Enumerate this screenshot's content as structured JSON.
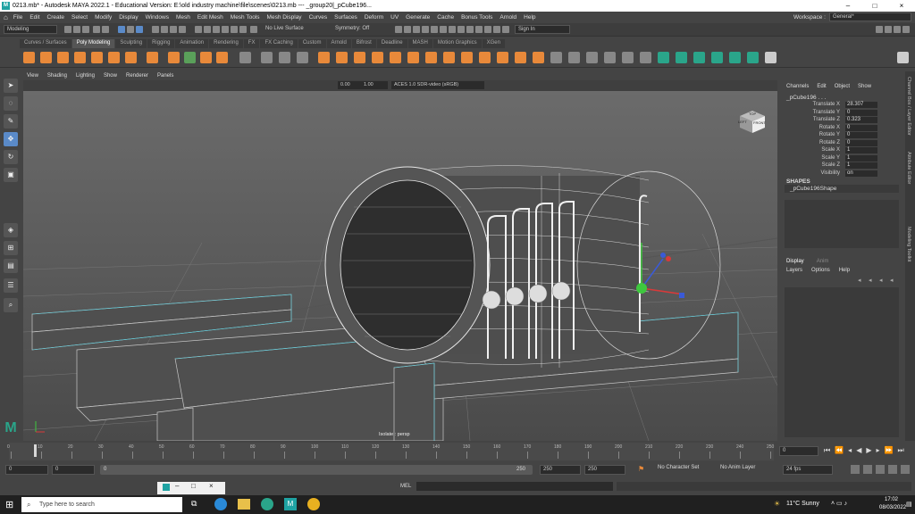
{
  "titlebar": {
    "text": "0213.mb* - Autodesk MAYA 2022.1 - Educational Version: E:\\old industry machine\\file\\scenes\\0213.mb  ---  _group20|_pCube196...",
    "logo": "M"
  },
  "menubar": {
    "items": [
      "File",
      "Edit",
      "Create",
      "Select",
      "Modify",
      "Display",
      "Windows",
      "Mesh",
      "Edit Mesh",
      "Mesh Tools",
      "Mesh Display",
      "Curves",
      "Surfaces",
      "Deform",
      "UV",
      "Generate",
      "Cache",
      "Bonus Tools",
      "Arnold",
      "Help"
    ],
    "workspace_label": "Workspace :",
    "workspace_value": "General*"
  },
  "statusline": {
    "mode": "Modeling",
    "live_surface": "No Live Surface",
    "symmetry": "Symmetry: Off",
    "sign_in": "Sign In"
  },
  "shelf_tabs": [
    "Curves / Surfaces",
    "Poly Modeling",
    "Sculpting",
    "Rigging",
    "Animation",
    "Rendering",
    "FX",
    "FX Caching",
    "Custom",
    "Arnold",
    "Bifrost",
    "Deadline",
    "MASH",
    "Motion Graphics",
    "XGen"
  ],
  "shelf_active": "Poly Modeling",
  "viewport": {
    "menu": [
      "View",
      "Shading",
      "Lighting",
      "Show",
      "Renderer",
      "Panels"
    ],
    "near_value": "0.00",
    "far_value": "1.00",
    "color_space": "ACES 1.0 SDR-video (sRGB)",
    "label": "Isolate : persp",
    "cube_top": "TOP",
    "cube_front": "FRONT",
    "cube_left": "LEFT"
  },
  "channelbox": {
    "tabs": [
      "Channels",
      "Edit",
      "Object",
      "Show"
    ],
    "object_name": "_pCube196 . . .",
    "attributes": [
      {
        "name": "Translate X",
        "value": "28.307"
      },
      {
        "name": "Translate Y",
        "value": "0"
      },
      {
        "name": "Translate Z",
        "value": "0.323"
      },
      {
        "name": "Rotate X",
        "value": "0"
      },
      {
        "name": "Rotate Y",
        "value": "0"
      },
      {
        "name": "Rotate Z",
        "value": "0"
      },
      {
        "name": "Scale X",
        "value": "1"
      },
      {
        "name": "Scale Y",
        "value": "1"
      },
      {
        "name": "Scale Z",
        "value": "1"
      },
      {
        "name": "Visibility",
        "value": "on"
      }
    ],
    "shapes_header": "SHAPES",
    "shape_name": "_pCube196Shape",
    "layer_tabs": [
      "Display",
      "Anim"
    ],
    "layer_menu": [
      "Layers",
      "Options",
      "Help"
    ]
  },
  "side_tabs": [
    "Channel Box / Layer Editor",
    "Attribute Editor",
    "Modeling Toolkit"
  ],
  "timeline": {
    "ticks": [
      "0",
      "10",
      "20",
      "30",
      "40",
      "50",
      "60",
      "70",
      "80",
      "90",
      "100",
      "110",
      "120",
      "130",
      "140",
      "150",
      "160",
      "170",
      "180",
      "190",
      "200",
      "210",
      "220",
      "230",
      "240",
      "250"
    ],
    "current_frame": "0"
  },
  "rangebar": {
    "start": "0",
    "inner_start": "0",
    "inner_end": "250",
    "outer_end": "250",
    "end": "250",
    "character_set": "No Character Set",
    "anim_layer": "No Anim Layer",
    "fps": "24 fps"
  },
  "cmdline": {
    "label": "MEL"
  },
  "taskbar": {
    "search_placeholder": "Type here to search",
    "weather": "11°C  Sunny",
    "time": "17:02",
    "date": "08/03/2022"
  }
}
